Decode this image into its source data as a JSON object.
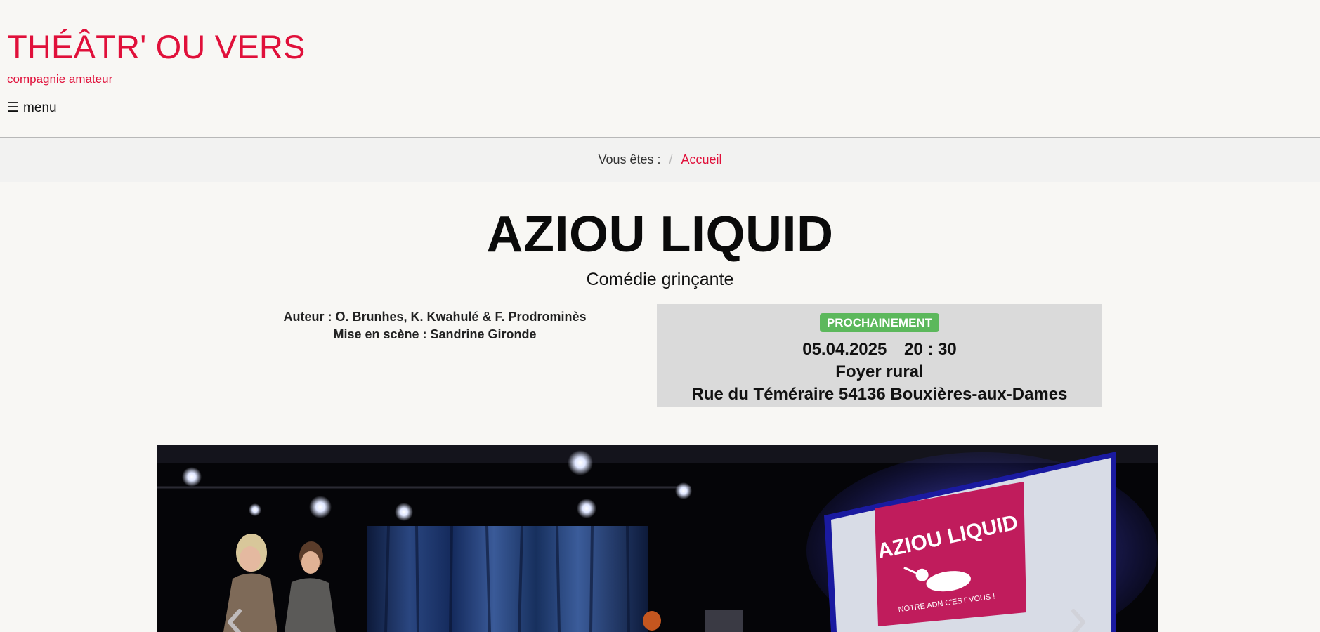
{
  "header": {
    "site_title": "THÉÂTR' OU VERS",
    "tagline": "compagnie amateur",
    "menu_icon": "☰",
    "menu_label": "menu"
  },
  "breadcrumb": {
    "prefix": "Vous êtes :",
    "separator": "/",
    "current": "Accueil"
  },
  "play": {
    "title": "AZIOU LIQUID",
    "genre": "Comédie grinçante",
    "author_line": "Auteur : O. Brunhes, K. Kwahulé & F. Prodrominès",
    "director_line": "Mise en scène : Sandrine Gironde"
  },
  "event": {
    "badge": "PROCHAINEMENT",
    "date": "05.04.2025",
    "time": "20 : 30",
    "venue": "Foyer rural",
    "address": "Rue du Téméraire 54136 Bouxières-aux-Dames"
  },
  "carousel": {
    "sign_text": "AZIOU LIQUID",
    "sign_subtext": "NOTRE ADN C'EST VOUS !",
    "prev_icon": "chevron-left-icon",
    "next_icon": "chevron-right-icon"
  },
  "colors": {
    "accent": "#e0103a",
    "badge_green": "#5cb85c",
    "event_box_bg": "#dadada",
    "page_bg": "#f8f7f4"
  }
}
